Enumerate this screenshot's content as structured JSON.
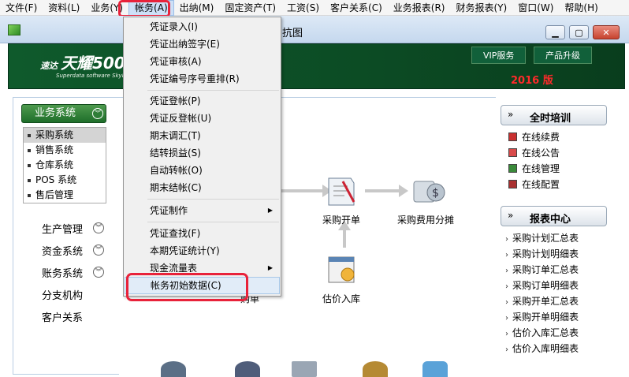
{
  "menubar": {
    "items": [
      "文件(F)",
      "资料(L)",
      "业务(Y)",
      "帐务(A)",
      "出纳(M)",
      "固定资产(T)",
      "工资(S)",
      "客户关系(C)",
      "业务报表(R)",
      "财务报表(Y)",
      "窗口(W)",
      "帮助(H)"
    ],
    "active_index": 3
  },
  "window": {
    "title": "流程图",
    "visible_title": "抗图"
  },
  "banner": {
    "logo_small": "速达",
    "logo_big": "天耀500",
    "logo_sub": "Superdata software Skybright",
    "vip_label": "VIP服务",
    "upgrade_label": "产品升级",
    "year": "2016 版"
  },
  "dropdown": {
    "items": [
      {
        "label": "凭证录入(I)"
      },
      {
        "label": "凭证出纳签字(E)"
      },
      {
        "label": "凭证审核(A)"
      },
      {
        "label": "凭证编号序号重排(R)"
      },
      {
        "label": "凭证登帐(P)"
      },
      {
        "label": "凭证反登帐(U)"
      },
      {
        "label": "期末调汇(T)"
      },
      {
        "label": "结转损益(S)"
      },
      {
        "label": "自动转帐(O)"
      },
      {
        "label": "期末结帐(C)"
      },
      {
        "label": "凭证制作",
        "submenu": true
      },
      {
        "label": "凭证查找(F)"
      },
      {
        "label": "本期凭证统计(Y)"
      },
      {
        "label": "现金流量表",
        "submenu": true
      },
      {
        "label": "帐务初始数据(C)",
        "hover": true
      }
    ]
  },
  "left": {
    "header": "业务系统",
    "subitems": [
      "采购系统",
      "销售系统",
      "仓库系统",
      "POS 系统",
      "售后管理"
    ],
    "groups": [
      "生产管理",
      "资金系统",
      "账务系统",
      "分支机构",
      "客户关系"
    ]
  },
  "main": {
    "nodes": [
      "采购开单",
      "采购费用分摊",
      "估价入库",
      "购单"
    ]
  },
  "right": {
    "training_title": "全时培训",
    "online_items": [
      "在线续费",
      "在线公告",
      "在线管理",
      "在线配置"
    ],
    "report_title": "报表中心",
    "report_items": [
      "采购计划汇总表",
      "采购计划明细表",
      "采购订单汇总表",
      "采购订单明细表",
      "采购开单汇总表",
      "采购开单明细表",
      "估价入库汇总表",
      "估价入库明细表"
    ]
  },
  "colors": {
    "banner_green": "#0c4b24",
    "highlight_red": "#e8223a",
    "year_red": "#ff2a2a"
  }
}
